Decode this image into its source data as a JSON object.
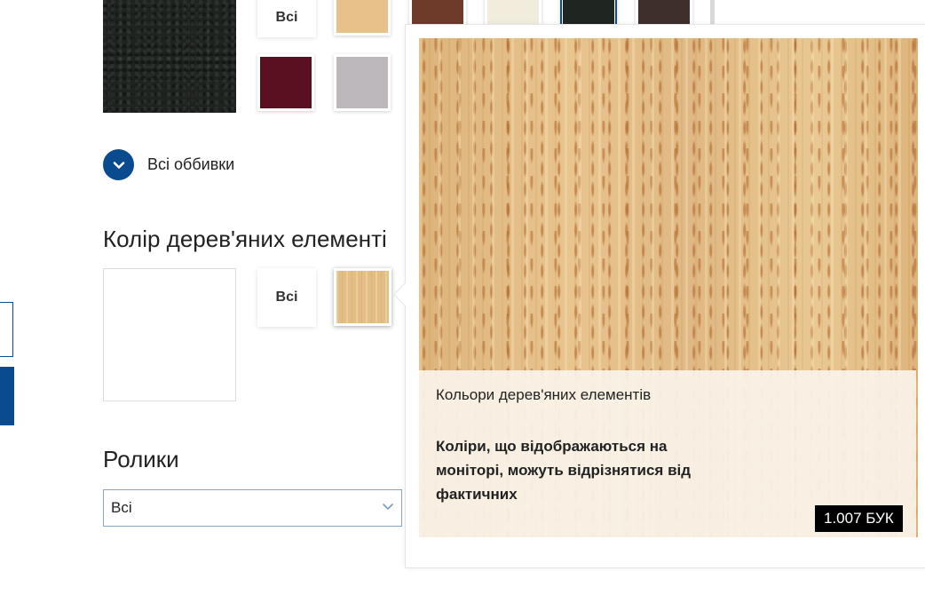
{
  "upholstery": {
    "all_label": "Всі",
    "more_label": "Всі оббивки",
    "swatch_colors": [
      "#e8c08a",
      "#6e3b2b",
      "#f1ecdc",
      "#1f2622",
      "#3f2f2c",
      "#5a1020",
      "#bdb8bb"
    ]
  },
  "wood": {
    "title": "Колір дерев'яних елементі",
    "all_label": "Всі",
    "swatch_color": "#e3bd86"
  },
  "rollers": {
    "title": "Ролики",
    "selected": "Всі"
  },
  "popover": {
    "category": "Кольори дерев'яних елементів",
    "note": "Коліри, що відображаються на моніторі, можуть відрізнятися від фактичних",
    "code": "1.007 БУК"
  },
  "colors": {
    "accent": "#0a4a8f",
    "caption_bg": "#faf3e9"
  }
}
